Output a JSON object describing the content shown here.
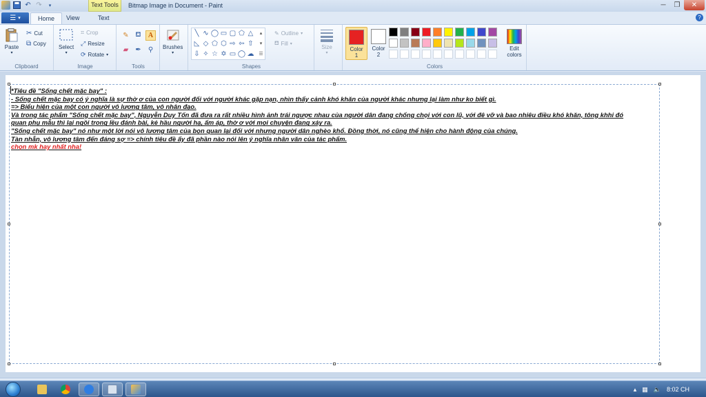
{
  "window": {
    "title": "Bitmap Image in Document - Paint",
    "context_tab": "Text Tools"
  },
  "tabs": [
    {
      "label": "Home"
    },
    {
      "label": "View"
    },
    {
      "label": "Text"
    }
  ],
  "ribbon": {
    "clipboard": {
      "paste": "Paste",
      "cut": "Cut",
      "copy": "Copy",
      "label": "Clipboard"
    },
    "image": {
      "select": "Select",
      "crop": "Crop",
      "resize": "Resize",
      "rotate": "Rotate",
      "label": "Image"
    },
    "tools": {
      "label": "Tools"
    },
    "brushes": {
      "label": "Brushes"
    },
    "shapes": {
      "outline": "Outline",
      "fill": "Fill",
      "label": "Shapes"
    },
    "size": {
      "label": "Size"
    },
    "colors": {
      "color1_label": "Color",
      "color1_num": "1",
      "color2_label": "Color",
      "color2_num": "2",
      "edit_label": "Edit",
      "edit_label2": "colors",
      "label": "Colors",
      "color1_value": "#e52222",
      "color2_value": "#ffffff",
      "palette": [
        "#000000",
        "#7f7f7f",
        "#880015",
        "#ed1c24",
        "#ff7f27",
        "#fff200",
        "#22b14c",
        "#00a2e8",
        "#3f48cc",
        "#a349a4",
        "#ffffff",
        "#c3c3c3",
        "#b97a57",
        "#ffaec9",
        "#ffc90e",
        "#efe4b0",
        "#b5e61d",
        "#99d9ea",
        "#7092be",
        "#c8bfe7",
        "#ffffff",
        "#ffffff",
        "#ffffff",
        "#ffffff",
        "#ffffff",
        "#ffffff",
        "#ffffff",
        "#ffffff",
        "#ffffff",
        "#ffffff"
      ]
    }
  },
  "canvas": {
    "lines": [
      "*Tiêu đề \"Sống chết mặc bay\" :",
      "- Sống chết mặc bay có ý nghĩa là sự thờ ơ của con người đối với người khác gặp nạn, nhìn thấy cảnh khó khăn của người khác nhưng lại làm như ko biết gì.",
      "=> Biểu hiện của một con người vô lương tâm, vô nhân đạo.",
      "Và trong tác phẩm \"Sống chết mặc bay\", Nguyễn Duy Tốn đã đưa ra rất nhiều hình ảnh trái ngược nhau của người dân đang chống chọi với con lũ, với đê vỡ và bao nhiêu điều khó khăn, tông khhi đó",
      "quan phụ mẫu thì lại ngồi trong lều đánh bài, kẻ hầu người hạ, ấm áp, thờ ơ với mọi chuyện đang xảy ra.",
      "\"Sống chết mặc bay\" nó như một lời nói vô lương tâm của bọn quan lại đối với nhưng người dân nghèo khổ. Đồng thời, nó cũng thể hiện cho hành động của chúng.",
      "Tàn nhẫn, vô lương tâm đến đáng sợ => chính tiêu đề ấy đã phần nào nói lên ý nghĩa nhân văn của tác phẩm."
    ],
    "red_line": "chọn mk hay nhất nha!",
    "red_color": "#e02020"
  },
  "taskbar": {
    "clock": "8:02 CH"
  }
}
